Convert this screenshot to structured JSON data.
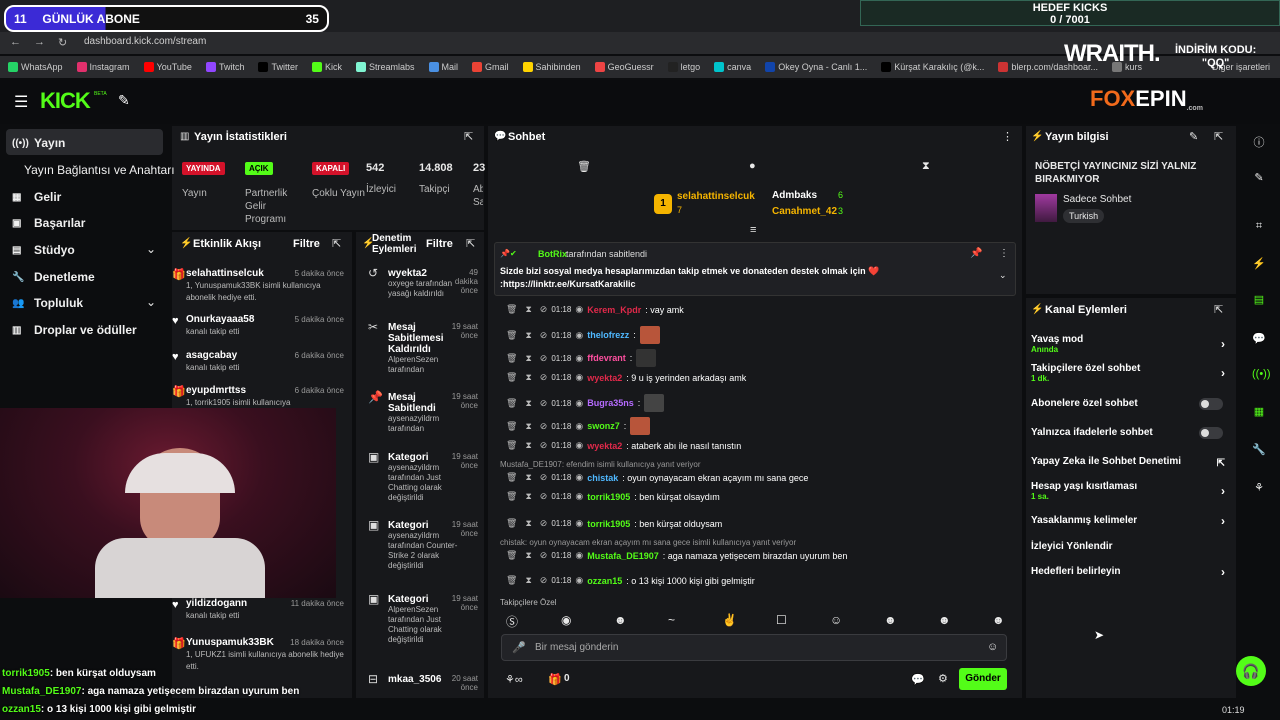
{
  "browser": {
    "url": "dashboard.kick.com/stream",
    "bookmarks": [
      "WhatsApp",
      "Instagram",
      "YouTube",
      "Twitch",
      "Twitter",
      "Kick",
      "Streamlabs",
      "Mail",
      "Gmail",
      "Sahibinden",
      "GeoGuessr",
      "letgo",
      "canva",
      "Okey Oyna - Canlı 1...",
      "Kürşat Karakılıç (@k...",
      "blerp.com/dashboar...",
      "kurs"
    ],
    "other_bookmarks": "Diğer işaretleri",
    "time": "01:19"
  },
  "overlay": {
    "abone_count_left": "11",
    "abone_label": "GÜNLÜK ABONE",
    "abone_count_right": "35",
    "hedef_title": "HEDEF KICKS",
    "hedef_value": "0 / 7001",
    "wraith": "WRAITH.",
    "indirim_1": "İNDİRİM KODU:",
    "indirim_2": "\"QQ\"",
    "fox_1": "FOX",
    "fox_2": "EPIN",
    "fox_com": ".com",
    "chat": [
      {
        "user": "torrik1905",
        "msg": ": ben kürşat olduysam"
      },
      {
        "user": "Mustafa_DE1907",
        "msg": ": aga namaza yetişecem birazdan uyurum ben"
      },
      {
        "user": "ozzan15",
        "msg": ": o 13 kişi 1000 kişi gibi gelmiştir"
      }
    ]
  },
  "kick": {
    "logo": "KICK",
    "beta": "BETA"
  },
  "sidebar": {
    "items": [
      {
        "label": "Yayın",
        "icon": "broadcast-icon"
      },
      {
        "label": "Yayın Bağlantısı ve Anahtarı",
        "icon": ""
      },
      {
        "label": "Gelir",
        "icon": "revenue-icon"
      },
      {
        "label": "Başarılar",
        "icon": "achievements-icon"
      },
      {
        "label": "Stüdyo",
        "icon": "studio-icon"
      },
      {
        "label": "Denetleme",
        "icon": "moderation-icon"
      },
      {
        "label": "Topluluk",
        "icon": "community-icon"
      },
      {
        "label": "Droplar ve ödüller",
        "icon": "drops-icon"
      }
    ]
  },
  "stats": {
    "title": "Yayın İstatistikleri",
    "badges": [
      {
        "badge": "YAYINDA",
        "label": "Yayın",
        "color": "#d4122a"
      },
      {
        "badge": "AÇIK",
        "label": "Partnerlik Gelir Programı",
        "color": "#53fc18"
      },
      {
        "badge": "KAPALI",
        "label": "Çoklu Yayın",
        "color": "#d4122a"
      }
    ],
    "numbers": [
      {
        "value": "542",
        "label": "İzleyici"
      },
      {
        "value": "14.808",
        "label": "Takipçi"
      },
      {
        "value": "23",
        "label": "Ab Sa"
      }
    ]
  },
  "feed": {
    "title": "Etkinlik Akışı",
    "filter": "Filtre",
    "items": [
      {
        "user": "selahattinselcuk",
        "time": "5 dakika önce",
        "desc": "1, Yunuspamuk33BK isimli kullanıcıya abonelik hediye etti.",
        "icon": "gift-icon"
      },
      {
        "user": "Onurkayaaa58",
        "time": "5 dakika önce",
        "desc": "kanalı takip etti",
        "icon": "heart-icon"
      },
      {
        "user": "asagcabay",
        "time": "6 dakika önce",
        "desc": "kanalı takip etti",
        "icon": "heart-icon"
      },
      {
        "user": "eyupdmrttss",
        "time": "6 dakika önce",
        "desc": "1, torrik1905 isimli kullanıcıya",
        "icon": "gift-icon"
      },
      {
        "user": "yildizdogann",
        "time": "11 dakika önce",
        "desc": "kanalı takip etti",
        "icon": "heart-icon"
      },
      {
        "user": "Yunuspamuk33BK",
        "time": "18 dakika önce",
        "desc": "1, UFUKZ1 isimli kullanıcıya abonelik hediye etti.",
        "icon": "gift-icon"
      }
    ]
  },
  "moderation": {
    "title": "Denetim Eylemleri",
    "filter": "Filtre",
    "items": [
      {
        "user": "wyekta2",
        "time": "49 dakika önce",
        "desc": "oxyege tarafından yasağı kaldırıldı"
      },
      {
        "user": "Mesaj Sabitlemesi Kaldırıldı",
        "time": "19 saat önce",
        "desc": "AlperenSezen tarafından"
      },
      {
        "user": "Mesaj Sabitlendi",
        "time": "19 saat önce",
        "desc": "aysenazyildrm tarafından"
      },
      {
        "user": "Kategori",
        "time": "19 saat önce",
        "desc": "aysenazyildrm tarafından Just Chatting olarak değiştirildi"
      },
      {
        "user": "Kategori",
        "time": "19 saat önce",
        "desc": "aysenazyildrm tarafından Counter-Strike 2 olarak değiştirildi"
      },
      {
        "user": "Kategori",
        "time": "19 saat önce",
        "desc": "AlperenSezen tarafından Just Chatting olarak değiştirildi"
      },
      {
        "user": "mkaa_3506",
        "time": "20 saat önce",
        "desc": ""
      }
    ]
  },
  "chat": {
    "title": "Sohbet",
    "leaders": [
      {
        "rank": "1",
        "name": "selahattinselcuk",
        "count": "7"
      },
      {
        "name": "Admbaks",
        "count": "6"
      },
      {
        "name": "Canahmet_42",
        "count": "3"
      }
    ],
    "pinned_by": "BotRix",
    "pinned_suffix": "tarafından sabitlendi",
    "pinned_text": "Sizde bizi sosyal medya hesaplarımızdan takip etmek ve donateden destek olmak için ❤️ :https://linktr.ee/KursatKarakilic",
    "messages": [
      {
        "time": "01:18",
        "user": "Kerem_Kpdr",
        "color": "#e0294a",
        "msg": ": vay amk"
      },
      {
        "time": "01:18",
        "user": "thelofrezz",
        "color": "#4fb8ff",
        "msg": ":",
        "emote": "#b8553a"
      },
      {
        "time": "01:18",
        "user": "ffdevrant",
        "color": "#ff4fa0",
        "msg": ":",
        "emote": "#333"
      },
      {
        "time": "01:18",
        "user": "wyekta2",
        "color": "#e0294a",
        "msg": ": 9 u iş yerinden arkadaşı amk"
      },
      {
        "time": "01:18",
        "user": "Bugra35ns",
        "color": "#b66bff",
        "msg": ":",
        "emote": "#444"
      },
      {
        "time": "01:18",
        "user": "swonz7",
        "color": "#53fc18",
        "msg": ":",
        "emote": "#b8553a"
      },
      {
        "time": "01:18",
        "user": "wyekta2",
        "color": "#e0294a",
        "msg": ": ataberk abı ile nasıl tanıstın"
      },
      {
        "reply": "Mustafa_DE1907: efendim isimli kullanıcıya yanıt veriyor",
        "time": "01:18",
        "user": "chistak",
        "color": "#4fb8ff",
        "msg": ": oyun oynayacam ekran açayım mı sana gece"
      },
      {
        "time": "01:18",
        "user": "torrik1905",
        "color": "#53fc18",
        "msg": ": ben kürşat olsaydım"
      },
      {
        "time": "01:18",
        "user": "torrik1905",
        "color": "#53fc18",
        "msg": ": ben kürşat olduysam"
      },
      {
        "reply": "chistak: oyun oynayacam ekran açayım mı sana gece isimli kullanıcıya yanıt veriyor",
        "time": "01:18",
        "user": "Mustafa_DE1907",
        "color": "#53fc18",
        "msg": ": aga namaza yetişecem birazdan uyurum ben"
      },
      {
        "time": "01:18",
        "user": "ozzan15",
        "color": "#53fc18",
        "msg": ": o 13 kişi 1000 kişi gibi gelmiştir"
      }
    ],
    "emote_section": "Takipçilere Özel",
    "input_placeholder": "Bir mesaj gönderin",
    "points": "0",
    "send": "Gönder"
  },
  "info": {
    "title": "Yayın bilgisi",
    "stream_title": "NÖBETÇİ YAYINCINIZ SİZİ YALNIZ BIRAKMIYOR",
    "category": "Sadece Sohbet",
    "tag": "Turkish"
  },
  "channel_actions": {
    "title": "Kanal Eylemleri",
    "rows": [
      {
        "label": "Yavaş mod",
        "sub": "Anında",
        "kind": "chevron"
      },
      {
        "label": "Takipçilere özel sohbet",
        "sub": "1 dk.",
        "kind": "chevron"
      },
      {
        "label": "Abonelere özel sohbet",
        "sub": "",
        "kind": "toggle"
      },
      {
        "label": "Yalnızca ifadelerle sohbet",
        "sub": "",
        "kind": "toggle"
      },
      {
        "label": "Yapay Zeka ile Sohbet Denetimi",
        "sub": "",
        "kind": "external"
      },
      {
        "label": "Hesap yaşı kısıtlaması",
        "sub": "1 sa.",
        "kind": "chevron"
      },
      {
        "label": "Yasaklanmış kelimeler",
        "sub": "",
        "kind": "chevron"
      },
      {
        "label": "İzleyici Yönlendir",
        "sub": "",
        "kind": "none"
      },
      {
        "label": "Hedefleri belirleyin",
        "sub": "",
        "kind": "chevron"
      }
    ]
  }
}
